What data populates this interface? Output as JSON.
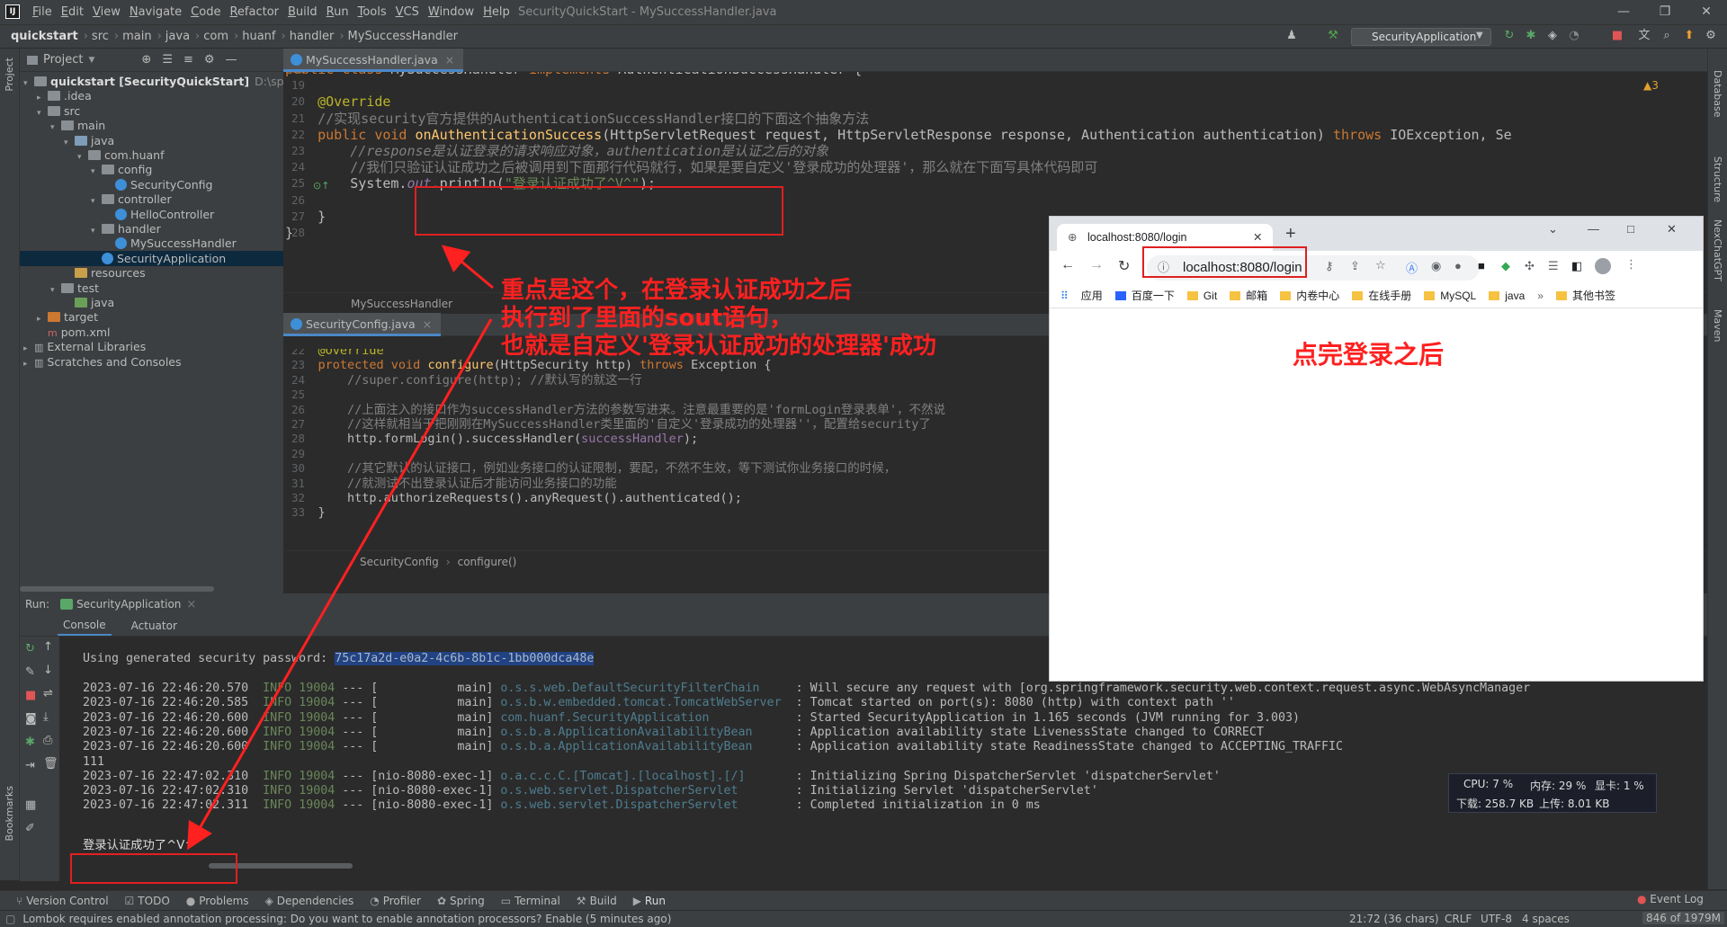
{
  "ide": {
    "logo": "IJ",
    "menus": [
      "File",
      "Edit",
      "View",
      "Navigate",
      "Code",
      "Refactor",
      "Build",
      "Run",
      "Tools",
      "VCS",
      "Window",
      "Help"
    ],
    "window_title": "SecurityQuickStart - MySuccessHandler.java",
    "breadcrumbs": [
      "quickstart",
      "src",
      "main",
      "java",
      "com",
      "huanf",
      "handler",
      "MySuccessHandler"
    ],
    "run_config": "SecurityApplication",
    "window_controls": {
      "minimize": "—",
      "restore": "❐",
      "close": "✕"
    }
  },
  "left_stripe": {
    "project": "Project",
    "bookmarks": "Bookmarks"
  },
  "right_stripe": {
    "database": "Database",
    "structure": "Structure",
    "chatgpt": "NexChatGPT",
    "maven": "Maven"
  },
  "project": {
    "title": "Project",
    "tree": [
      {
        "label": "quickstart [SecurityQuickStart]",
        "suffix": "D:\\springs",
        "type": "module",
        "depth": 0,
        "arrow": "▾"
      },
      {
        "label": ".idea",
        "type": "folder",
        "depth": 1,
        "arrow": "▸"
      },
      {
        "label": "src",
        "type": "folder",
        "depth": 1,
        "arrow": "▾"
      },
      {
        "label": "main",
        "type": "folder",
        "depth": 2,
        "arrow": "▾"
      },
      {
        "label": "java",
        "type": "src",
        "depth": 3,
        "arrow": "▾"
      },
      {
        "label": "com.huanf",
        "type": "folder",
        "depth": 4,
        "arrow": "▾"
      },
      {
        "label": "config",
        "type": "folder",
        "depth": 5,
        "arrow": "▾"
      },
      {
        "label": "SecurityConfig",
        "type": "class",
        "depth": 6,
        "arrow": ""
      },
      {
        "label": "controller",
        "type": "folder",
        "depth": 5,
        "arrow": "▾"
      },
      {
        "label": "HelloController",
        "type": "class",
        "depth": 6,
        "arrow": ""
      },
      {
        "label": "handler",
        "type": "folder",
        "depth": 5,
        "arrow": "▾"
      },
      {
        "label": "MySuccessHandler",
        "type": "class",
        "depth": 6,
        "arrow": ""
      },
      {
        "label": "SecurityApplication",
        "type": "class",
        "depth": 5,
        "arrow": "",
        "selected": true
      },
      {
        "label": "resources",
        "type": "res",
        "depth": 3,
        "arrow": ""
      },
      {
        "label": "test",
        "type": "folder",
        "depth": 2,
        "arrow": "▾"
      },
      {
        "label": "java",
        "type": "test",
        "depth": 3,
        "arrow": ""
      },
      {
        "label": "target",
        "type": "target",
        "depth": 1,
        "arrow": "▸"
      },
      {
        "label": "pom.xml",
        "type": "file",
        "depth": 1,
        "arrow": ""
      },
      {
        "label": "External Libraries",
        "type": "lib",
        "depth": 0,
        "arrow": "▸"
      },
      {
        "label": "Scratches and Consoles",
        "type": "lib",
        "depth": 0,
        "arrow": "▸"
      }
    ]
  },
  "editor_top": {
    "tab": "MySuccessHandler.java",
    "warnings": "▲3",
    "lines": [
      {
        "n": "18",
        "html": "<span class='kw'>public class</span> MySuccessHandler <span class='kw'>implements</span> AuthenticationSuccessHandler {"
      },
      {
        "n": "19",
        "html": ""
      },
      {
        "n": "20",
        "html": "    <span class='ann'>@Override</span>"
      },
      {
        "n": "21",
        "html": "    <span class='cm'>//实现security官方提供的AuthenticationSuccessHandler接口的下面这个抽象方法</span>"
      },
      {
        "n": "22",
        "html": "    <span class='kw'>public void</span> <span class='fn'>onAuthenticationSuccess</span>(HttpServletRequest request, HttpServletResponse response, Authentication authentication) <span class='kw'>throws</span> IOException, Se"
      },
      {
        "n": "23",
        "html": "        <span class='cm itl'>//response是认证登录的请求响应对象，authentication是认证之后的对象</span>"
      },
      {
        "n": "24",
        "html": "        <span class='cm'>//我们只验证认证成功之后被调用到下面那行代码就行，如果是要自定义'登录成功的处理器'，那么就在下面写具体代码即可</span>"
      },
      {
        "n": "25",
        "html": "        System.<span class='fld itl'>out</span>.println(<span class='str'>\"登录认证成功了^V^\"</span>);"
      },
      {
        "n": "26",
        "html": ""
      },
      {
        "n": "27",
        "html": "    }"
      },
      {
        "n": "28",
        "html": "}"
      }
    ],
    "breadcrumb": "MySuccessHandler"
  },
  "editor_bottom": {
    "tab": "SecurityConfig.java",
    "lines": [
      {
        "n": "22",
        "html": "    <span class='ann'>@Override</span>"
      },
      {
        "n": "23",
        "html": "    <span class='kw'>protected void</span> <span class='fn'>configure</span>(HttpSecurity http) <span class='kw'>throws</span> Exception {"
      },
      {
        "n": "24",
        "html": "        <span class='cm'>//super.configure(http); //默认写的就这一行</span>"
      },
      {
        "n": "25",
        "html": ""
      },
      {
        "n": "26",
        "html": "        <span class='cm'>//上面注入的接口作为successHandler方法的参数写进来。注意最重要的是'formLogin登录表单'，不然说</span>"
      },
      {
        "n": "27",
        "html": "        <span class='cm'>//这样就相当于把刚刚在MySuccessHandler类里面的'自定义'登录成功的处理器''，配置给security了</span>"
      },
      {
        "n": "28",
        "html": "        http.formLogin().successHandler(<span class='fld'>successHandler</span>);"
      },
      {
        "n": "29",
        "html": ""
      },
      {
        "n": "30",
        "html": "        <span class='cm'>//其它默认的认证接口，例如业务接口的认证限制，要配，不然不生效，等下测试你业务接口的时候，</span>"
      },
      {
        "n": "31",
        "html": "        <span class='cm'>//就测试不出登录认证后才能访问业务接口的功能</span>"
      },
      {
        "n": "32",
        "html": "        http.authorizeRequests().anyRequest().authenticated();"
      },
      {
        "n": "33",
        "html": "    }"
      }
    ],
    "breadcrumb": [
      "SecurityConfig",
      "configure()"
    ]
  },
  "run": {
    "label": "Run:",
    "config_tab": "SecurityApplication",
    "subtabs": [
      "Console",
      "Actuator"
    ],
    "password_prefix": "Using generated security password: ",
    "password": "75c17a2d-e0a2-4c6b-8b1c-1bb000dca48e",
    "log": [
      {
        "ts": "2023-07-16 22:46:20.570",
        "lvl": "INFO",
        "pid": "19004",
        "thread": "[           main]",
        "cls": "o.s.s.web.DefaultSecurityFilterChain    ",
        "msg": ": Will secure any request with [org.springframework.security.web.context.request.async.WebAsyncManager"
      },
      {
        "ts": "2023-07-16 22:46:20.585",
        "lvl": "INFO",
        "pid": "19004",
        "thread": "[           main]",
        "cls": "o.s.b.w.embedded.tomcat.TomcatWebServer ",
        "msg": ": Tomcat started on port(s): 8080 (http) with context path ''"
      },
      {
        "ts": "2023-07-16 22:46:20.600",
        "lvl": "INFO",
        "pid": "19004",
        "thread": "[           main]",
        "cls": "com.huanf.SecurityApplication           ",
        "msg": ": Started SecurityApplication in 1.165 seconds (JVM running for 3.003)"
      },
      {
        "ts": "2023-07-16 22:46:20.600",
        "lvl": "INFO",
        "pid": "19004",
        "thread": "[           main]",
        "cls": "o.s.b.a.ApplicationAvailabilityBean     ",
        "msg": ": Application availability state LivenessState changed to CORRECT"
      },
      {
        "ts": "2023-07-16 22:46:20.600",
        "lvl": "INFO",
        "pid": "19004",
        "thread": "[           main]",
        "cls": "o.s.b.a.ApplicationAvailabilityBean     ",
        "msg": ": Application availability state ReadinessState changed to ACCEPTING_TRAFFIC"
      },
      {
        "plain": "111"
      },
      {
        "ts": "2023-07-16 22:47:02.310",
        "lvl": "INFO",
        "pid": "19004",
        "thread": "[nio-8080-exec-1]",
        "cls": "o.a.c.c.C.[Tomcat].[localhost].[/]      ",
        "msg": ": Initializing Spring DispatcherServlet 'dispatcherServlet'"
      },
      {
        "ts": "2023-07-16 22:47:02.310",
        "lvl": "INFO",
        "pid": "19004",
        "thread": "[nio-8080-exec-1]",
        "cls": "o.s.web.servlet.DispatcherServlet       ",
        "msg": ": Initializing Servlet 'dispatcherServlet'"
      },
      {
        "ts": "2023-07-16 22:47:02.311",
        "lvl": "INFO",
        "pid": "19004",
        "thread": "[nio-8080-exec-1]",
        "cls": "o.s.web.servlet.DispatcherServlet       ",
        "msg": ": Completed initialization in 0 ms"
      }
    ],
    "success_output": "登录认证成功了^V^"
  },
  "tool_tabs": [
    "Version Control",
    "TODO",
    "Problems",
    "Dependencies",
    "Profiler",
    "Spring",
    "Terminal",
    "Build",
    "Run"
  ],
  "event_log": "Event Log",
  "status": {
    "message": "Lombok requires enabled annotation processing: Do you want to enable annotation processors? Enable (5 minutes ago)",
    "position": "21:72 (36 chars)",
    "line_sep": "CRLF",
    "encoding": "UTF-8",
    "indent": "4 spaces",
    "memory": "846 of 1979M"
  },
  "browser": {
    "tab_title": "localhost:8080/login",
    "url": "localhost:8080/login",
    "bookmarks": [
      "应用",
      "百度一下",
      "Git",
      "邮箱",
      "内卷中心",
      "在线手册",
      "MySQL",
      "java"
    ],
    "more": "»",
    "other_bookmarks": "其他书签",
    "controls": {
      "down": "⌄",
      "minimize": "—",
      "maximize": "□",
      "close": "✕"
    }
  },
  "annotations": {
    "main": [
      "重点是这个，在登录认证成功之后",
      "执行到了里面的sout语句，",
      "也就是自定义'登录认证成功的处理器'成功"
    ],
    "browser_note": "点完登录之后"
  },
  "sysmon": {
    "cpu": "CPU: 7 %",
    "mem": "内存: 29 %",
    "gpu": "显卡: 1 %",
    "down": "下载: 258.7 KB",
    "up": "上传: 8.01 KB"
  },
  "colors": {
    "accent": "#4a88c7",
    "annotation_red": "#ff2020",
    "editor_bg": "#2b2b2b",
    "panel_bg": "#3c3f41"
  }
}
